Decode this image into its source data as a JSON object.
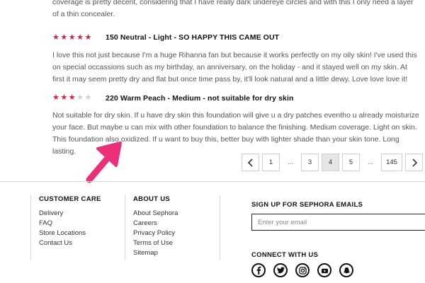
{
  "reviews": [
    {
      "text": "coverage is pretty decent, considering that I have really dark undereye circles and with this I only need a layer of a thin concealer."
    },
    {
      "rating": 5,
      "title": "150 Neutral - Light - SO HAPPY THIS CAME OUT",
      "text": "I love this not just because I'm a huge Rihanna fan but because it works perfectly on my oily skin! I've used this on special occassions such as my birthday, an anniversary, on the holiday - and it stayed well on my skin. At first it may seem pretty dry and flat but once time pass by, it'll look natural and a little dewy. Love love love it!"
    },
    {
      "rating": 3,
      "title": "220 Warm Peach - Medium - not suitable for dry skin",
      "text": "Not suitable for dry skin. If u have dry skin this foundation will give u a dry patches eventho u already moisturize your face. But maybe u can mix with other foundation to balance the finishing. Medium coverage. Light on skin. This foundation also oxidized. If u want to buy this, better buy with lighter shade than your skin tone. Long lasting."
    }
  ],
  "annotation": {
    "color": "#ec2f7b"
  },
  "colors": {
    "star_on": "#e01b3a",
    "star_off": "#cfcfcf"
  },
  "pagination": {
    "prev_icon": "chevron-left-icon",
    "next_icon": "chevron-right-icon",
    "pages": [
      "1",
      "...",
      "3",
      "4",
      "5",
      "...",
      "145"
    ],
    "current": "4"
  },
  "footer": {
    "customer_care": {
      "heading": "CUSTOMER CARE",
      "links": [
        "Delivery",
        "FAQ",
        "Store Locations",
        "Contact Us"
      ]
    },
    "about": {
      "heading": "ABOUT US",
      "links": [
        "About Sephora",
        "Careers",
        "Privacy Policy",
        "Terms of Use",
        "Sitemap"
      ]
    },
    "signup": {
      "heading": "SIGN UP FOR SEPHORA EMAILS",
      "placeholder": "Enter your email"
    },
    "connect": {
      "heading": "CONNECT WITH US",
      "icons": [
        "facebook-icon",
        "twitter-icon",
        "instagram-icon",
        "youtube-icon",
        "snapchat-icon"
      ]
    }
  }
}
